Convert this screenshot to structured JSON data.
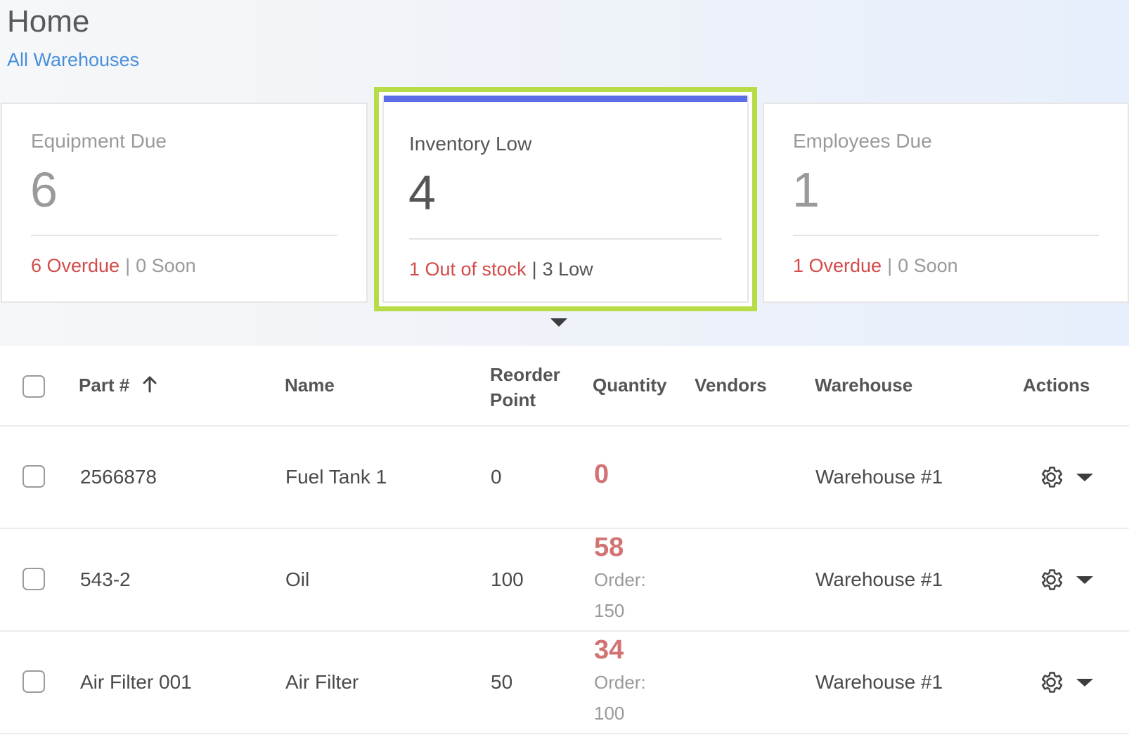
{
  "page": {
    "title": "Home",
    "breadcrumb": "All Warehouses"
  },
  "cards": [
    {
      "label": "Equipment Due",
      "count": "6",
      "primary": "6 Overdue",
      "separator": "|",
      "secondary": "0 Soon"
    },
    {
      "label": "Inventory Low",
      "count": "4",
      "primary": "1 Out of stock",
      "separator": "|",
      "secondary": "3 Low"
    },
    {
      "label": "Employees Due",
      "count": "1",
      "primary": "1 Overdue",
      "separator": "|",
      "secondary": "0 Soon"
    }
  ],
  "table": {
    "headers": {
      "part": "Part #",
      "name": "Name",
      "reorder_line1": "Reorder",
      "reorder_line2": "Point",
      "quantity": "Quantity",
      "vendors": "Vendors",
      "warehouse": "Warehouse",
      "actions": "Actions"
    },
    "rows": [
      {
        "part": "2566878",
        "name": "Fuel Tank 1",
        "reorder": "0",
        "quantity": "0",
        "order_label": "",
        "order_value": "",
        "vendors": "",
        "warehouse": "Warehouse #1"
      },
      {
        "part": "543-2",
        "name": "Oil",
        "reorder": "100",
        "quantity": "58",
        "order_label": "Order:",
        "order_value": "150",
        "vendors": "",
        "warehouse": "Warehouse #1"
      },
      {
        "part": "Air Filter 001",
        "name": "Air Filter",
        "reorder": "50",
        "quantity": "34",
        "order_label": "Order:",
        "order_value": "100",
        "vendors": "",
        "warehouse": "Warehouse #1"
      }
    ]
  },
  "colors": {
    "accent_border": "#b7dc47",
    "active_bar": "#5b6ee8",
    "danger_text": "#d34b4b",
    "low_qty": "#d27373",
    "link": "#4a8fdb"
  },
  "icons": [
    "sort-ascending-icon",
    "gear-icon",
    "chevron-down-icon",
    "caret-down-icon"
  ]
}
